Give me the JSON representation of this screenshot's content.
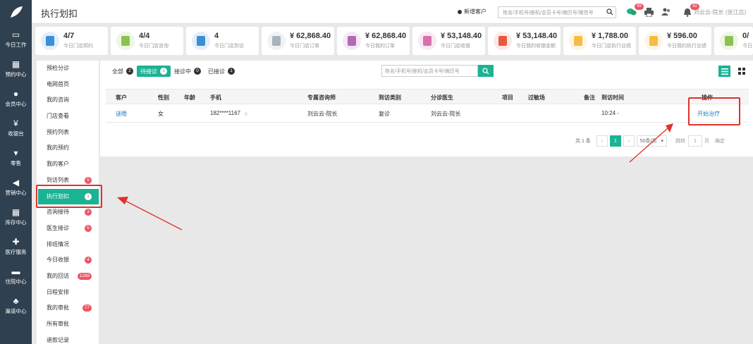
{
  "header": {
    "title": "执行划扣",
    "new_customer": "新增客户",
    "search_placeholder": "姓名/手机号/座机/会员卡号/病历号/微信号",
    "chat_badge": "69",
    "bell_badge": "92",
    "user": "刘云云-院长 (张江店)"
  },
  "sidebar": {
    "items": [
      {
        "label": "今日工作",
        "icon": "monitor-icon"
      },
      {
        "label": "预约中心",
        "icon": "calendar-icon"
      },
      {
        "label": "会员中心",
        "icon": "users-icon"
      },
      {
        "label": "收银台",
        "icon": "yen-icon"
      },
      {
        "label": "零售",
        "icon": "cart-icon"
      },
      {
        "label": "营销中心",
        "icon": "megaphone-icon"
      },
      {
        "label": "库存中心",
        "icon": "grid-icon"
      },
      {
        "label": "医疗服务",
        "icon": "medkit-icon"
      },
      {
        "label": "住院中心",
        "icon": "bed-icon"
      },
      {
        "label": "渠道中心",
        "icon": "sitemap-icon"
      }
    ]
  },
  "stats": [
    {
      "value": "4/7",
      "label": "今日门店预约",
      "color": "#3a8fd9",
      "bg": "#e3eefa"
    },
    {
      "value": "4/4",
      "label": "今日门店咨询",
      "color": "#8cc152",
      "bg": "#eef6e4"
    },
    {
      "value": "4",
      "label": "今日门店到访",
      "color": "#3a8fd9",
      "bg": "#e3eefa"
    },
    {
      "value": "¥ 62,868.40",
      "label": "今日门店订单",
      "color": "#aab2bd",
      "bg": "#f1f2f4"
    },
    {
      "value": "¥ 62,868.40",
      "label": "今日我的订单",
      "color": "#b06ab3",
      "bg": "#f4e8f5"
    },
    {
      "value": "¥ 53,148.40",
      "label": "今日门店收银",
      "color": "#d770ad",
      "bg": "#f9e8f2"
    },
    {
      "value": "¥ 53,148.40",
      "label": "今日我的收银金额",
      "color": "#e9573f",
      "bg": "#fbe9e6"
    },
    {
      "value": "¥ 1,788.00",
      "label": "今日门店执行业绩",
      "color": "#f6bb42",
      "bg": "#fdf4e2"
    },
    {
      "value": "¥ 596.00",
      "label": "今日我的执行业绩",
      "color": "#f6bb42",
      "bg": "#fdf4e2"
    },
    {
      "value": "0/",
      "label": "今日",
      "color": "#8cc152",
      "bg": "#eef6e4"
    }
  ],
  "subnav": {
    "items": [
      {
        "label": "预检分诊",
        "badge": ""
      },
      {
        "label": "电网首页",
        "badge": ""
      },
      {
        "label": "我的咨询",
        "badge": ""
      },
      {
        "label": "门店查看",
        "badge": ""
      },
      {
        "label": "预约列表",
        "badge": ""
      },
      {
        "label": "我的预约",
        "badge": ""
      },
      {
        "label": "我的客户",
        "badge": ""
      },
      {
        "label": "到访列表",
        "badge": "5"
      },
      {
        "label": "执行划扣",
        "badge": "1"
      },
      {
        "label": "咨询接待",
        "badge": "3"
      },
      {
        "label": "医生接诊",
        "badge": "5"
      },
      {
        "label": "排班情况",
        "badge": ""
      },
      {
        "label": "今日收银",
        "badge": "4"
      },
      {
        "label": "我的回访",
        "badge": "1288"
      },
      {
        "label": "日程安排",
        "badge": ""
      },
      {
        "label": "我的审批",
        "badge": "77"
      },
      {
        "label": "所有审批",
        "badge": ""
      },
      {
        "label": "退款记录",
        "badge": ""
      }
    ]
  },
  "tabs": [
    {
      "label": "全部",
      "count": "2"
    },
    {
      "label": "待接诊",
      "count": "1"
    },
    {
      "label": "接诊中",
      "count": "0"
    },
    {
      "label": "已接诊",
      "count": "1"
    }
  ],
  "table_search_placeholder": "姓名/手机号/座机/会员卡号/病历号",
  "table": {
    "headers": [
      "客户",
      "性别",
      "年龄",
      "手机",
      "专属咨询师",
      "到访类别",
      "分诊医生",
      "项目",
      "过敏场",
      "备注",
      "到访时间",
      "操作"
    ],
    "rows": [
      {
        "customer": "谜瞪",
        "gender": "女",
        "age": "",
        "phone": "182****1167",
        "phone_note": "◎",
        "consultant": "刘云云-院长",
        "visit_type": "复诊",
        "doctor": "刘云云-院长",
        "project": "",
        "allergy": "",
        "note": "",
        "time": "10:24 -",
        "action": "开始治疗"
      }
    ]
  },
  "pagination": {
    "total": "共 1 条",
    "prev": "‹",
    "page": "1",
    "next": "›",
    "page_size": "50条/页",
    "goto": "跳转",
    "goto_page": "1",
    "page_unit": "页",
    "confirm": "确定"
  }
}
